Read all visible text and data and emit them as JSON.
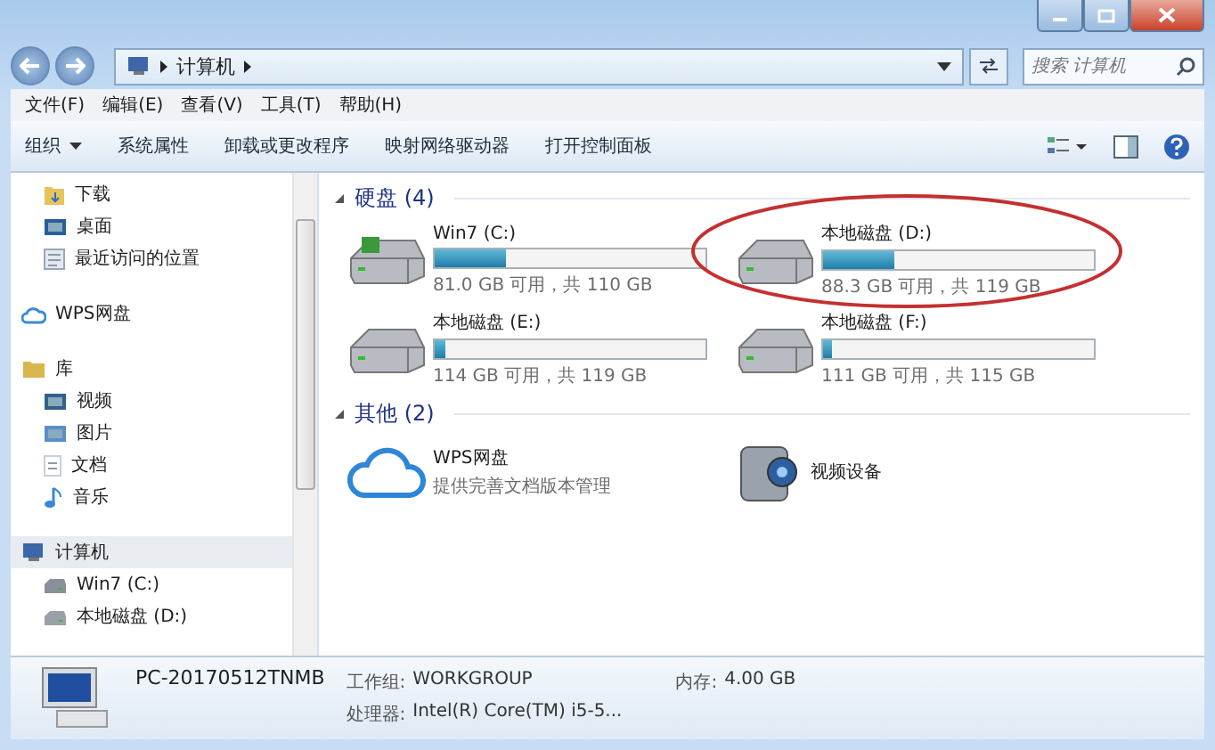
{
  "address_bar": {
    "path": [
      "计算机"
    ],
    "search_placeholder": "搜索 计算机"
  },
  "menu": [
    {
      "label": "文件(F)"
    },
    {
      "label": "编辑(E)"
    },
    {
      "label": "查看(V)"
    },
    {
      "label": "工具(T)"
    },
    {
      "label": "帮助(H)"
    }
  ],
  "toolbar": [
    {
      "label": "组织",
      "dropdown": true
    },
    {
      "label": "系统属性",
      "dropdown": false
    },
    {
      "label": "卸载或更改程序",
      "dropdown": false
    },
    {
      "label": "映射网络驱动器",
      "dropdown": false
    },
    {
      "label": "打开控制面板",
      "dropdown": false
    }
  ],
  "sidebar": {
    "groups": [
      {
        "items": [
          {
            "kind": "download",
            "label": "下载",
            "selected": false
          },
          {
            "kind": "desktop",
            "label": "桌面",
            "selected": false
          },
          {
            "kind": "recent",
            "label": "最近访问的位置",
            "selected": false
          }
        ]
      },
      {
        "kind": "cloud",
        "label": "WPS网盘",
        "selected": false
      },
      {
        "kind": "library",
        "label": "库",
        "selected": false,
        "items": [
          {
            "kind": "video",
            "label": "视频",
            "selected": false
          },
          {
            "kind": "picture",
            "label": "图片",
            "selected": false
          },
          {
            "kind": "document",
            "label": "文档",
            "selected": false
          },
          {
            "kind": "music",
            "label": "音乐",
            "selected": false
          }
        ]
      },
      {
        "kind": "computer",
        "label": "计算机",
        "selected": true,
        "items": [
          {
            "kind": "system-drive",
            "label": "Win7 (C:)",
            "selected": false
          },
          {
            "kind": "drive",
            "label": "本地磁盘 (D:)",
            "selected": false
          }
        ]
      }
    ]
  },
  "sections": [
    {
      "title": "硬盘 (4)",
      "expanded": true,
      "items": [
        {
          "kind": "system-drive",
          "name": "Win7 (C:)",
          "level": 0.26,
          "reading": "81.0 GB 可用，共 110 GB"
        },
        {
          "kind": "drive",
          "name": "本地磁盘 (D:)",
          "level": 0.26,
          "reading": "88.3 GB 可用，共 119 GB"
        },
        {
          "kind": "drive",
          "name": "本地磁盘 (E:)",
          "level": 0.04,
          "reading": "114 GB 可用，共 119 GB"
        },
        {
          "kind": "drive",
          "name": "本地磁盘 (F:)",
          "level": 0.035,
          "reading": "111 GB 可用，共 115 GB"
        }
      ]
    },
    {
      "title": "其他 (2)",
      "expanded": true,
      "items": [
        {
          "kind": "cloud",
          "name": "WPS网盘",
          "reading": "提供完善文档版本管理"
        },
        {
          "kind": "camera",
          "name": "视频设备"
        }
      ]
    }
  ],
  "details": {
    "computer_name": "PC-20170512TNMB",
    "fields": [
      {
        "label": "工作组:",
        "value": "WORKGROUP"
      },
      {
        "label": "内存:",
        "value": "4.00 GB"
      },
      {
        "label": "处理器:",
        "value": "Intel(R) Core(TM) i5-5..."
      }
    ]
  }
}
